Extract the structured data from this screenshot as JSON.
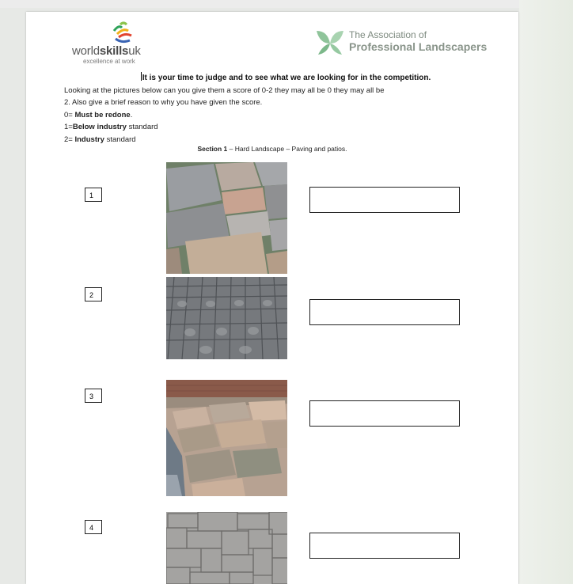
{
  "logos": {
    "worldskills_part1": "world",
    "worldskills_part2": "skills",
    "worldskills_part3": "uk",
    "worldskills_tagline": "excellence at work",
    "apl_line1": "The Association of",
    "apl_line2": "Professional Landscapers"
  },
  "intro": {
    "heading": "It is your time to judge and to see what we are looking for in the competition.",
    "line1": "Looking at the pictures below can you give them a score of 0-2 they may all be 0 they may all be",
    "line2": "2. Also give a brief reason to why you have given the score.",
    "score0_prefix": "0= ",
    "score0_bold": "Must be redone",
    "score0_suffix": ".",
    "score1_prefix": "1=",
    "score1_bold": "Below industry",
    "score1_suffix": " standard",
    "score2_prefix": "2= ",
    "score2_bold": "Industry",
    "score2_suffix": " standard"
  },
  "section": {
    "label": "Section 1",
    "text": " – Hard Landscape – Paving and patios."
  },
  "items": [
    {
      "number": "1"
    },
    {
      "number": "2"
    },
    {
      "number": "3"
    },
    {
      "number": "4"
    }
  ],
  "colors": {
    "page_bg": "#ffffff",
    "desk_bg": "#e7e9e6",
    "apl_green": "#8fc49a"
  }
}
